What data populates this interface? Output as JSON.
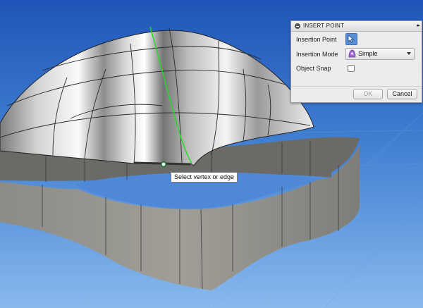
{
  "panel": {
    "title": "INSERT POINT",
    "insertion_point_label": "Insertion Point",
    "insertion_mode_label": "Insertion Mode",
    "insertion_mode_value": "Simple",
    "object_snap_label": "Object Snap",
    "object_snap_checked": false,
    "ok_label": "OK",
    "cancel_label": "Cancel"
  },
  "tooltip": {
    "text": "Select vertex or edge"
  },
  "colors": {
    "background_top": "#1a4fb5",
    "background_bottom": "#76abe8",
    "surface": "#8a8a8a",
    "highlight_curve": "#22dd22",
    "select_button": "#5a8fd8"
  }
}
